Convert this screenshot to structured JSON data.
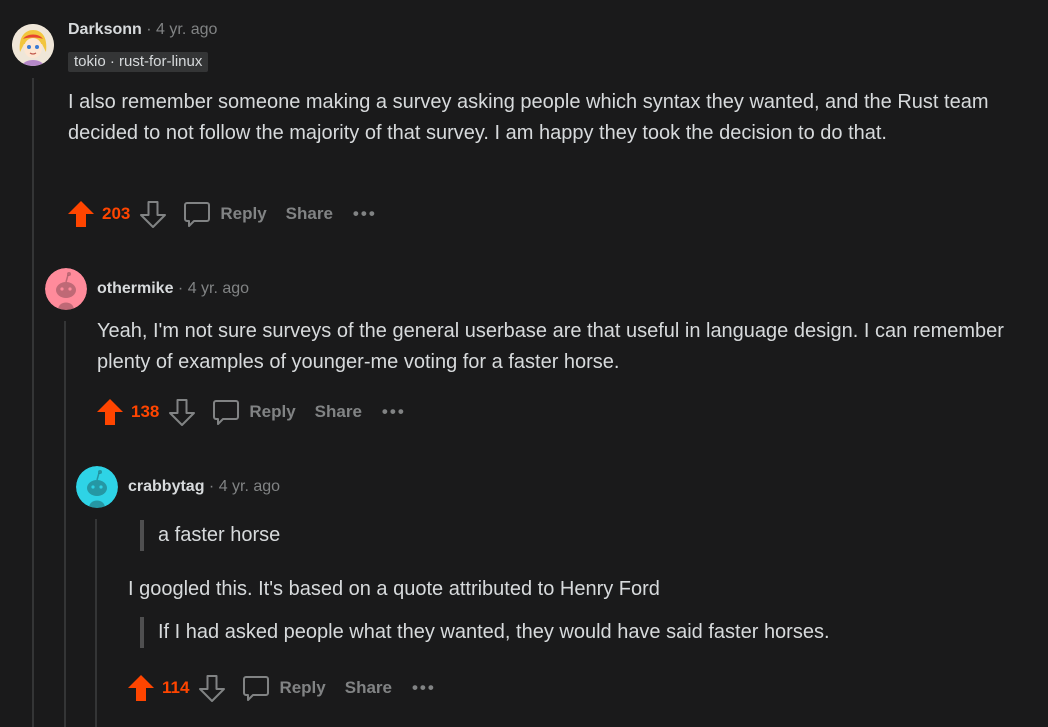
{
  "comments": [
    {
      "author": "Darksonn",
      "separator": "·",
      "age": "4 yr. ago",
      "flair": "tokio · rust-for-linux",
      "body": "I also remember someone making a survey asking people which syntax they wanted, and the Rust team decided to not follow the majority of that survey. I am happy they took the decision to do that.",
      "score": "203",
      "reply_label": "Reply",
      "share_label": "Share",
      "more_label": "•••"
    },
    {
      "author": "othermike",
      "separator": "·",
      "age": "4 yr. ago",
      "body": "Yeah, I'm not sure surveys of the general userbase are that useful in language design. I can remember plenty of examples of younger-me voting for a faster horse.",
      "score": "138",
      "reply_label": "Reply",
      "share_label": "Share",
      "more_label": "•••"
    },
    {
      "author": "crabbytag",
      "separator": "·",
      "age": "4 yr. ago",
      "quote1": "a faster horse",
      "paragraph": "I googled this. It's based on a quote attributed to Henry Ford",
      "quote2": "If I had asked people what they wanted, they would have said faster horses.",
      "score": "114",
      "reply_label": "Reply",
      "share_label": "Share",
      "more_label": "•••"
    }
  ],
  "colors": {
    "background": "#1a1a1b",
    "upvoted": "#ff4500",
    "muted": "#818384",
    "text": "#d7dadc",
    "thread_line": "#343536"
  },
  "icons": {
    "upvote": "arrow-up-icon",
    "downvote": "arrow-down-icon",
    "reply": "comment-bubble-icon",
    "more": "more-horizontal-icon"
  }
}
